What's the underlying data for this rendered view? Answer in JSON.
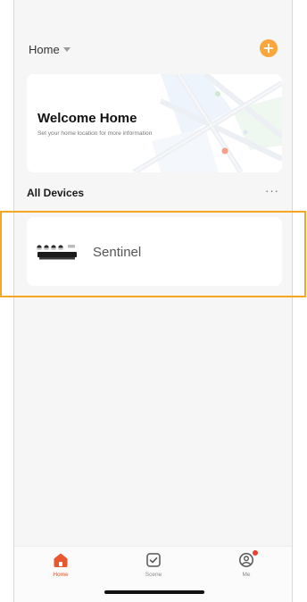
{
  "header": {
    "home_title": "Home"
  },
  "welcome": {
    "title": "Welcome Home",
    "subtitle": "Set your home location for more information"
  },
  "devices": {
    "section_title": "All Devices",
    "more_label": "···",
    "items": [
      {
        "name": "Sentinel"
      }
    ]
  },
  "tabs": [
    {
      "label": "Home",
      "icon": "home-icon",
      "active": true
    },
    {
      "label": "Scene",
      "icon": "scene-checkbox-icon",
      "active": false
    },
    {
      "label": "Me",
      "icon": "profile-icon",
      "active": false
    }
  ],
  "colors": {
    "accent": "#f9a73c",
    "active_tab": "#e8572e",
    "highlight": "#f5a623",
    "background": "#f6f6f6"
  }
}
